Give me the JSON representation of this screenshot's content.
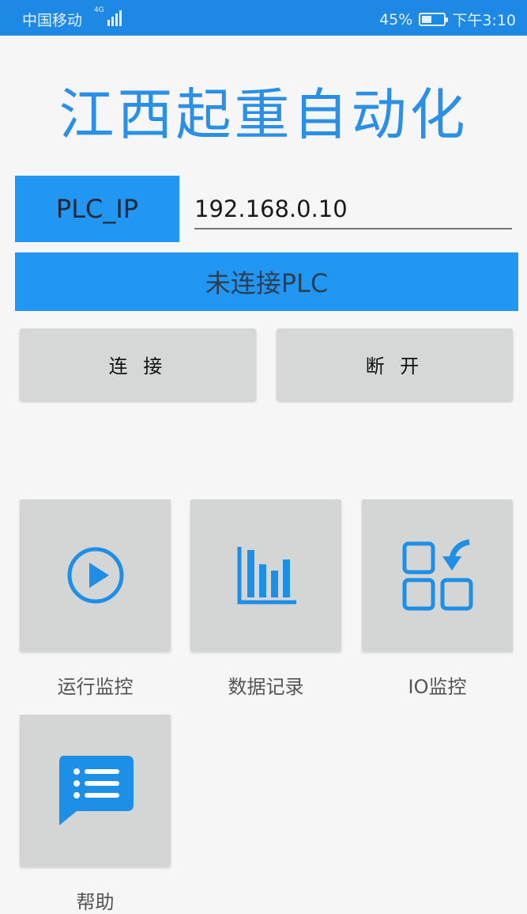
{
  "status_bar": {
    "carrier": "中国移动",
    "network": "4G",
    "battery": "45%",
    "battery_level": 0.45,
    "time": "下午3:10"
  },
  "app": {
    "title": "江西起重自动化"
  },
  "connection": {
    "ip_label": "PLC_IP",
    "ip_value": "192.168.0.10",
    "status_text": "未连接PLC",
    "connect_label": "连 接",
    "disconnect_label": "断 开"
  },
  "menu": {
    "items": [
      {
        "label": "运行监控",
        "icon": "play-circle-icon"
      },
      {
        "label": "数据记录",
        "icon": "bar-chart-icon"
      },
      {
        "label": "IO监控",
        "icon": "io-grid-icon"
      },
      {
        "label": "帮助",
        "icon": "help-message-icon"
      }
    ]
  },
  "colors": {
    "status_bar": "#1e88e5",
    "accent": "#2196f3",
    "title": "#2a8fe6",
    "tile_bg": "#d4d5d5"
  }
}
